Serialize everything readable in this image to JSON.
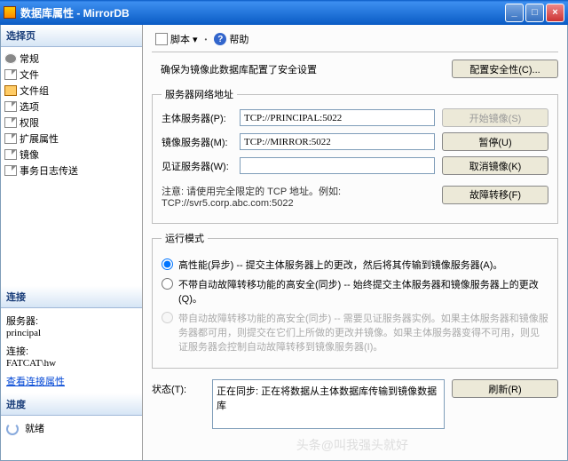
{
  "window": {
    "title": "数据库属性 - MirrorDB"
  },
  "sidebar": {
    "pages_header": "选择页",
    "tree": [
      {
        "label": "常规"
      },
      {
        "label": "文件"
      },
      {
        "label": "文件组"
      },
      {
        "label": "选项"
      },
      {
        "label": "权限"
      },
      {
        "label": "扩展属性"
      },
      {
        "label": "镜像"
      },
      {
        "label": "事务日志传送"
      }
    ],
    "conn_header": "连接",
    "server_lbl": "服务器:",
    "server_val": "principal",
    "conn_lbl": "连接:",
    "conn_val": "FATCAT\\hw",
    "view_conn": "查看连接属性",
    "progress_header": "进度",
    "progress_val": "就绪"
  },
  "toolbar": {
    "script": "脚本",
    "help": "帮助"
  },
  "main": {
    "msg": "确保为镜像此数据库配置了安全设置",
    "cfg_btn": "配置安全性(C)...",
    "addr_legend": "服务器网络地址",
    "principal_lbl": "主体服务器(P):",
    "principal_val": "TCP://PRINCIPAL:5022",
    "mirror_lbl": "镜像服务器(M):",
    "mirror_val": "TCP://MIRROR:5022",
    "witness_lbl": "见证服务器(W):",
    "witness_val": "",
    "start_btn": "开始镜像(S)",
    "pause_btn": "暂停(U)",
    "remove_btn": "取消镜像(K)",
    "failover_btn": "故障转移(F)",
    "note": "注意: 请使用完全限定的 TCP 地址。例如: TCP://svr5.corp.abc.com:5022",
    "mode_legend": "运行模式",
    "mode_hi": "高性能(异步) -- 提交主体服务器上的更改，然后将其传输到镜像服务器(A)。",
    "mode_noauto": "不带自动故障转移功能的高安全(同步) -- 始终提交主体服务器和镜像服务器上的更改(Q)。",
    "mode_auto": "带自动故障转移功能的高安全(同步) -- 需要见证服务器实例。如果主体服务器和镜像服务器都可用，则提交在它们上所做的更改并镜像。如果主体服务器变得不可用，则见证服务器会控制自动故障转移到镜像服务器(I)。",
    "status_lbl": "状态(T):",
    "status_val": "正在同步: 正在将数据从主体数据库传输到镜像数据库",
    "refresh_btn": "刷新(R)"
  },
  "watermark": "头条@叫我强头就好"
}
